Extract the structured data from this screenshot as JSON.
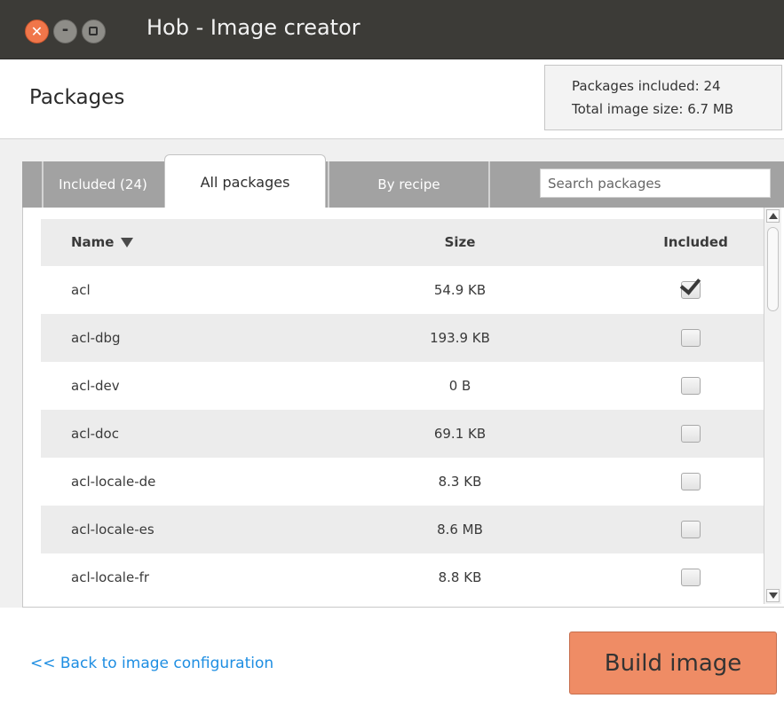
{
  "window": {
    "title": "Hob - Image creator",
    "controls": {
      "close_glyph": "✕",
      "minimize_glyph": "-"
    }
  },
  "header": {
    "title": "Packages",
    "summary": {
      "packages_included": "Packages included: 24",
      "total_size": "Total image size:  6.7 MB"
    }
  },
  "tabs": [
    {
      "label": "Included (24)",
      "active": false
    },
    {
      "label": "All packages",
      "active": true
    },
    {
      "label": "By recipe",
      "active": false
    }
  ],
  "search": {
    "placeholder": "Search packages",
    "value": ""
  },
  "table": {
    "columns": {
      "name": "Name",
      "size": "Size",
      "included": "Included"
    },
    "sort": {
      "column": "name",
      "direction": "descending-arrow"
    },
    "rows": [
      {
        "name": "acl",
        "size": "54.9 KB",
        "included": true
      },
      {
        "name": "acl-dbg",
        "size": "193.9 KB",
        "included": false
      },
      {
        "name": "acl-dev",
        "size": "0 B",
        "included": false
      },
      {
        "name": "acl-doc",
        "size": "69.1 KB",
        "included": false
      },
      {
        "name": "acl-locale-de",
        "size": "8.3 KB",
        "included": false
      },
      {
        "name": "acl-locale-es",
        "size": "8.6 MB",
        "included": false
      },
      {
        "name": "acl-locale-fr",
        "size": "8.8 KB",
        "included": false
      }
    ]
  },
  "footer": {
    "back_link": "<< Back to image configuration",
    "build_button": "Build image"
  },
  "colors": {
    "titlebar": "#3c3b37",
    "close_button": "#f0764a",
    "tab_inactive": "#a2a2a2",
    "link": "#1e8ee2",
    "build_button": "#ef8c65"
  }
}
